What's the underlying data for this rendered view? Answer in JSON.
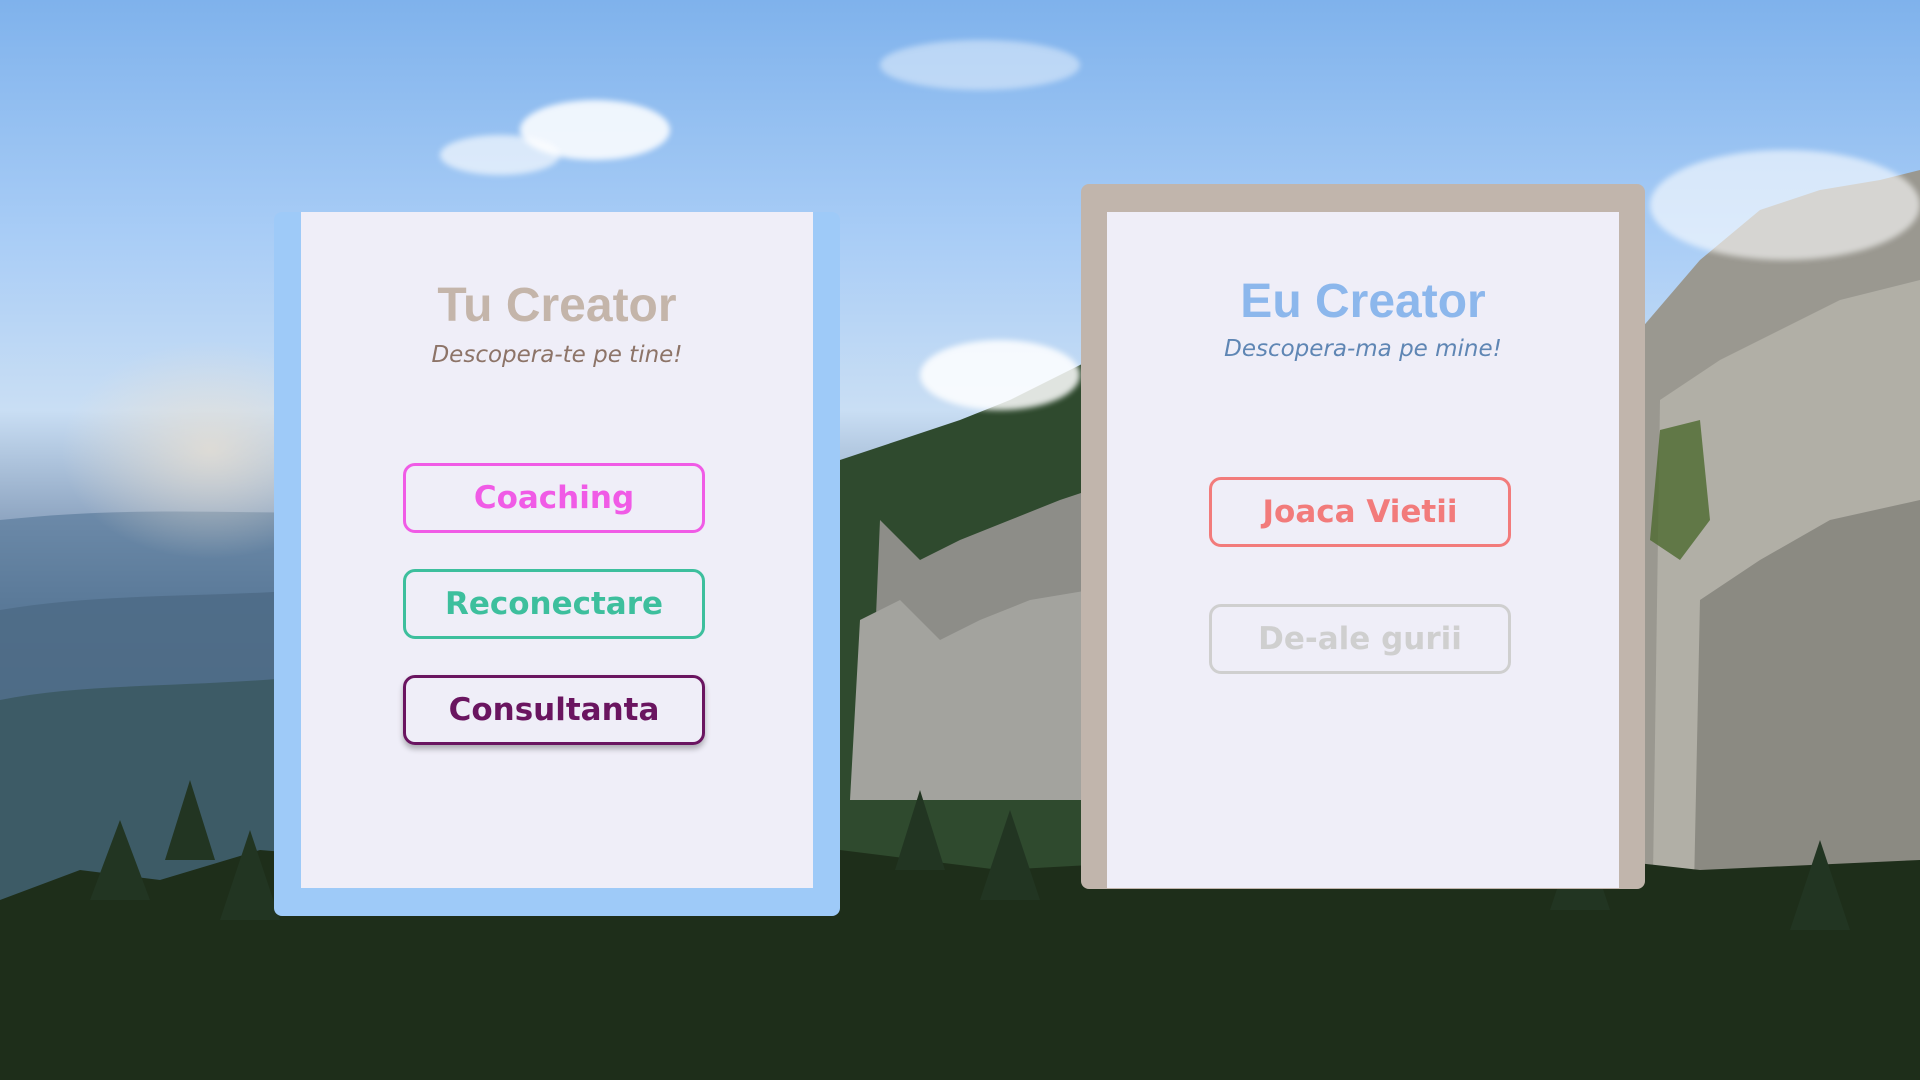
{
  "left_panel": {
    "title": "Tu Creator",
    "subtitle": "Descopera-te pe tine!",
    "frame_color": "#9ecaf8",
    "buttons": [
      {
        "label": "Coaching",
        "color": "#f05be6"
      },
      {
        "label": "Reconectare",
        "color": "#3dbf9d"
      },
      {
        "label": "Consultanta",
        "color": "#6a1560"
      }
    ]
  },
  "right_panel": {
    "title": "Eu Creator",
    "subtitle": "Descopera-ma pe mine!",
    "frame_color": "#c1b5ac",
    "buttons": [
      {
        "label": "Joaca Vietii",
        "color": "#f27b7b"
      },
      {
        "label": "De-ale gurii",
        "color": "#cfcfcf"
      }
    ]
  },
  "background": {
    "scene": "mountain-cliffs-forest-sky"
  }
}
